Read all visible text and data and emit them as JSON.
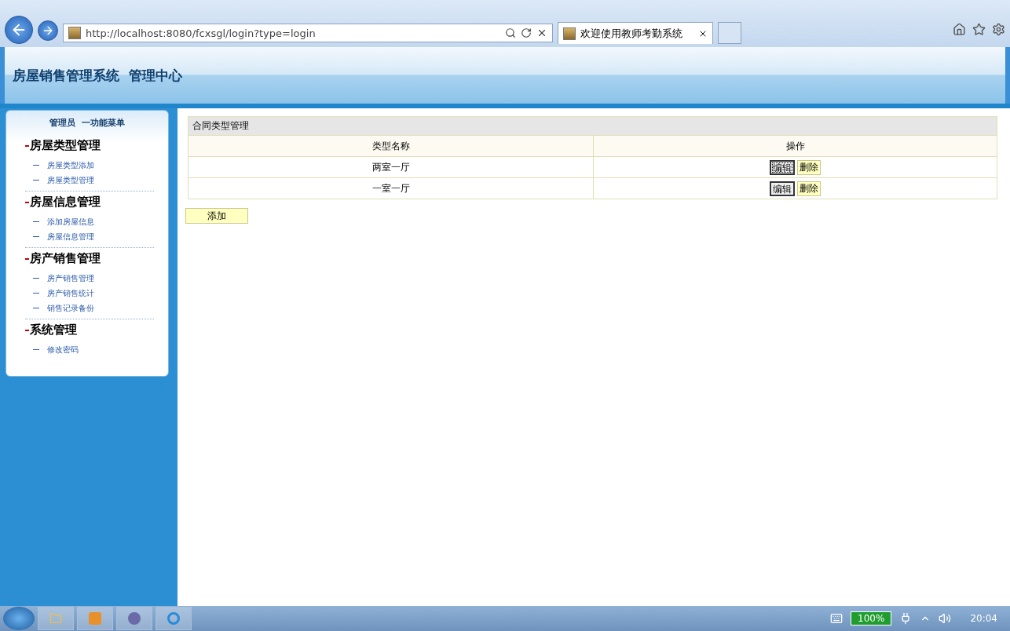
{
  "browser": {
    "address": "http://localhost:8080/fcxsgl/login?type=login",
    "tab_title": "欢迎使用教师考勤系统"
  },
  "header": {
    "title": "房屋销售管理系统  管理中心"
  },
  "sidebar": {
    "title": "管理员  一功能菜单",
    "groups": [
      {
        "title": "房屋类型管理",
        "items": [
          "房屋类型添加",
          "房屋类型管理"
        ]
      },
      {
        "title": "房屋信息管理",
        "items": [
          "添加房屋信息",
          "房屋信息管理"
        ]
      },
      {
        "title": "房产销售管理",
        "items": [
          "房产销售管理",
          "房产销售统计",
          "销售记录备份"
        ]
      },
      {
        "title": "系统管理",
        "items": [
          "修改密码"
        ]
      }
    ]
  },
  "table": {
    "caption": "合同类型管理",
    "columns": [
      "类型名称",
      "操作"
    ],
    "rows": [
      {
        "name": "两室一厅",
        "edit": "编辑",
        "delete": "删除",
        "edit_focused": true
      },
      {
        "name": "一室一厅",
        "edit": "编辑",
        "delete": "删除",
        "edit_focused": false
      }
    ]
  },
  "add_button": "添加",
  "taskbar": {
    "battery": "100%",
    "clock": "20:04"
  }
}
